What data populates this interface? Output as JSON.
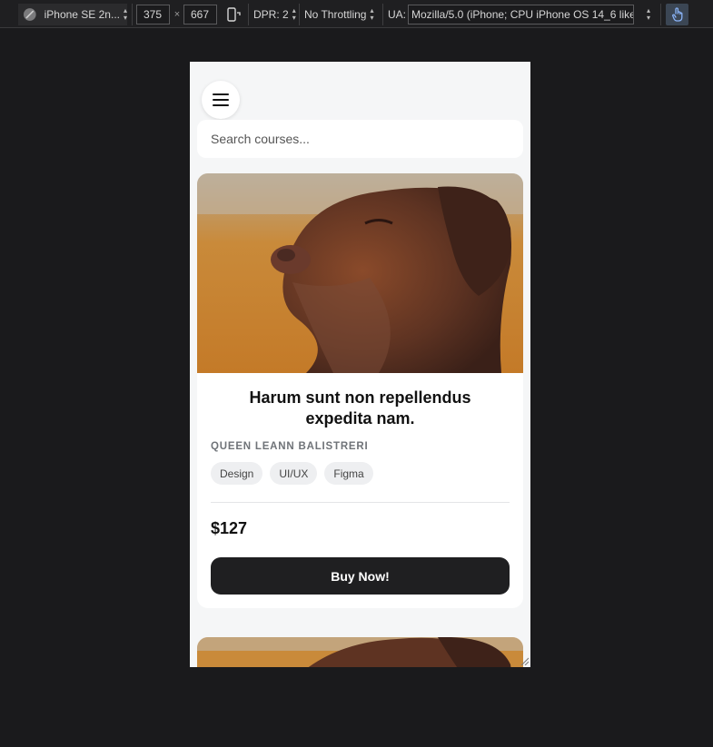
{
  "devtools": {
    "device": "iPhone SE 2n...",
    "width": "375",
    "times": "×",
    "height": "667",
    "dpr": "DPR: 2",
    "throttling": "No Throttling",
    "ua_label": "UA:",
    "ua_value": "Mozilla/5.0 (iPhone; CPU iPhone OS 14_6 like I"
  },
  "page": {
    "search_placeholder": "Search courses...",
    "course": {
      "title": "Harum sunt non repellendus expedita nam.",
      "author": "QUEEN LEANN BALISTRERI",
      "tags": [
        "Design",
        "UI/UX",
        "Figma"
      ],
      "price": "$127",
      "cta": "Buy Now!"
    }
  }
}
